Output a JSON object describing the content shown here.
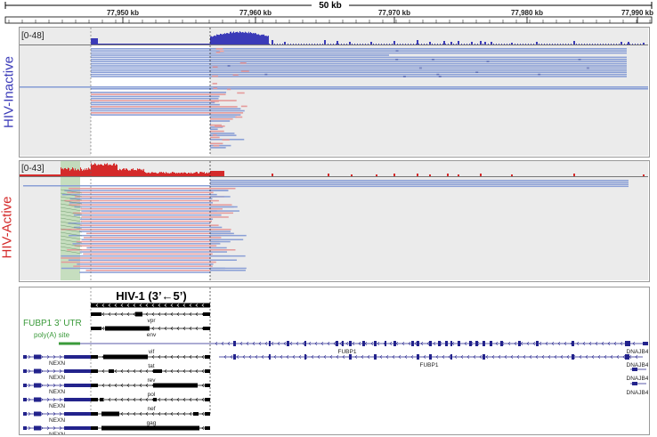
{
  "ruler": {
    "span_label": "50 kb",
    "ticks": [
      "77,950 kb",
      "77,960 kb",
      "77,970 kb",
      "77,980 kb",
      "77,990 kb"
    ]
  },
  "tracks": {
    "inactive": {
      "side_label": "HIV-Inactive",
      "range": "[0-48]",
      "color": "#3b3bb8"
    },
    "active": {
      "side_label": "HIV-Active",
      "range": "[0-43]",
      "color": "#d42a2a"
    }
  },
  "annotation": {
    "hiv_title": "HIV-1 (3’←5’)",
    "utr_label": "FUBP1 3’ UTR",
    "polya_label": "poly(A) site",
    "hiv_genes": [
      "vpr",
      "env",
      "vif",
      "tat",
      "rev",
      "pol",
      "nef",
      "gag"
    ],
    "nexn_labels": [
      "NEXN",
      "NEXN",
      "NEXN",
      "NEXN",
      "NEXN",
      "NEXN"
    ],
    "fubp1_labels": [
      "FUBP1",
      "FUBP1"
    ],
    "dnajb4_labels": [
      "DNAJB4",
      "DNAJB4",
      "DNAJB4",
      "DNAJB4"
    ]
  },
  "colors": {
    "gene": "#23238c",
    "hiv": "#000000",
    "utr": "#3a9a3a",
    "read_blue": "#8a9fd6",
    "read_pink": "#e59a9a",
    "shade": "#ebebeb"
  }
}
